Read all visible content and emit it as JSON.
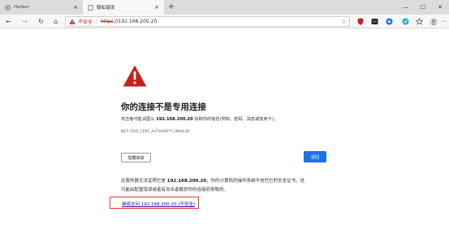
{
  "tabs": [
    {
      "title": "Harbor",
      "close": "×"
    },
    {
      "title": "隐私错误",
      "close": "×"
    }
  ],
  "new_tab": "+",
  "window_controls": {
    "minimize": "—",
    "maximize": "☐",
    "close": "✕"
  },
  "nav": {
    "back": "←",
    "forward": "→",
    "reload": "↻",
    "home": "⌂"
  },
  "address": {
    "insecure_label": "不安全",
    "separator": "|",
    "scheme": "https",
    "url_rest": "://192.168.200.20"
  },
  "toolbar_icons": {
    "favorite": "☆",
    "more": "···"
  },
  "page": {
    "heading": "你的连接不是专用连接",
    "desc_prefix": "攻击者可能试图从 ",
    "host": "192.168.200.20",
    "desc_suffix": " 窃取你的信息(例如，密码、消息或信用卡)。",
    "error_code": "NET::ERR_CERT_AUTHORITY_INVALID",
    "advanced_button": "隐藏高级",
    "back_button": "返回",
    "detail1_prefix": "此服务器无法证明它是 ",
    "detail1_host": "192.168.200.20",
    "detail1_suffix": "；你的计算机的操作系统不信任它的安全证书。这",
    "detail2": "可能由配置错误或者有攻击者截获你的连接而导致的。",
    "proceed_link": "继续访问 192.168.200.20 (不安全)"
  },
  "colors": {
    "danger": "#c5221f",
    "accent": "#1a73e8",
    "highlight_box": "#e53935"
  }
}
